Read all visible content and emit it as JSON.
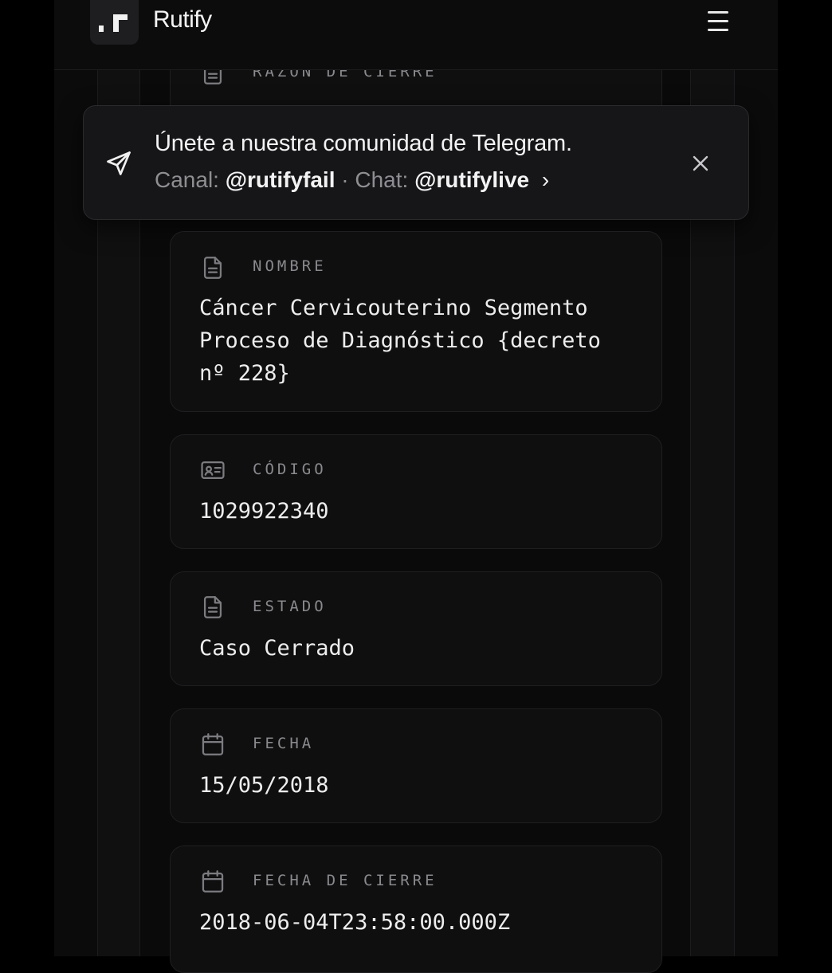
{
  "app": {
    "brand": "Rutify",
    "menu_icon": "hamburger-menu-icon"
  },
  "banner": {
    "title": "Únete a nuestra comunidad de Telegram.",
    "channel_prefix": "Canal:",
    "channel_handle": "@rutifyfail",
    "separator": "·",
    "chat_prefix": "Chat:",
    "chat_handle": "@rutifylive",
    "chevron": "›",
    "send_icon": "send-icon",
    "close_icon": "close-icon"
  },
  "partial_card": {
    "label": "RAZÓN DE CIERRE",
    "icon": "document-icon"
  },
  "fields": [
    {
      "label": "NOMBRE",
      "value": "Cáncer Cervicouterino Segmento Proceso de Diagnóstico {decreto nº 228}",
      "icon": "document-icon"
    },
    {
      "label": "CÓDIGO",
      "value": "1029922340",
      "icon": "id-card-icon"
    },
    {
      "label": "ESTADO",
      "value": "Caso Cerrado",
      "icon": "document-icon"
    },
    {
      "label": "FECHA",
      "value": "15/05/2018",
      "icon": "calendar-icon"
    },
    {
      "label": "FECHA DE CIERRE",
      "value": "2018-06-04T23:58:00.000Z",
      "icon": "calendar-icon"
    }
  ],
  "colors": {
    "background": "#0b0b0c",
    "card": "#0f0f10",
    "text": "#ededee",
    "muted": "#8a8a8e"
  }
}
